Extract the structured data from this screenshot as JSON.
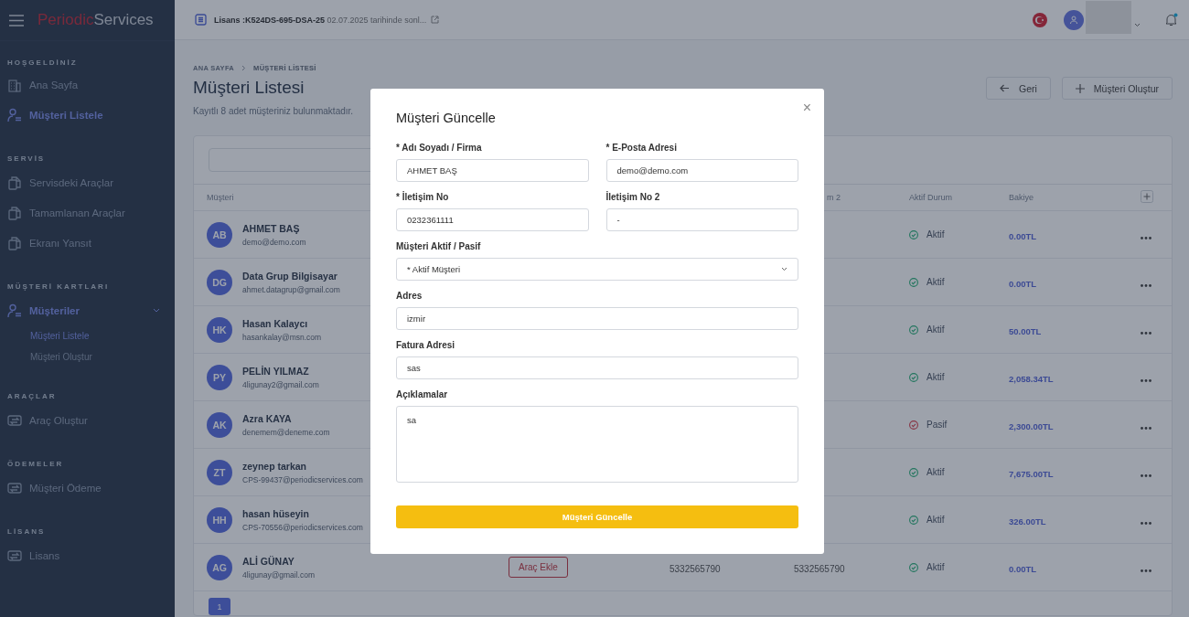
{
  "brand": {
    "first": "Periodic",
    "second": "Services"
  },
  "sidebar": {
    "sections": [
      {
        "title": "HOŞGELDİNİZ",
        "items": [
          {
            "label": "Ana Sayfa",
            "kind": "building",
            "selected": false
          },
          {
            "label": "Müşteri Listele",
            "kind": "user-list",
            "selected": true
          }
        ]
      },
      {
        "title": "SERVİS",
        "items": [
          {
            "label": "Servisdeki Araçlar",
            "kind": "copy",
            "selected": false
          },
          {
            "label": "Tamamlanan Araçlar",
            "kind": "copy",
            "selected": false
          },
          {
            "label": "Ekranı Yansıt",
            "kind": "copy",
            "selected": false
          }
        ]
      },
      {
        "title": "MÜŞTERİ KARTLARI",
        "items": [
          {
            "label": "Müşteriler",
            "kind": "user-list",
            "selected": true,
            "expanded": true,
            "children": [
              {
                "label": "Müşteri Listele",
                "selected": true
              },
              {
                "label": "Müşteri Oluştur",
                "selected": false
              }
            ]
          }
        ]
      },
      {
        "title": "ARAÇLAR",
        "items": [
          {
            "label": "Araç Oluştur",
            "kind": "transfer",
            "selected": false
          }
        ]
      },
      {
        "title": "ÖDEMELER",
        "items": [
          {
            "label": "Müşteri Ödeme",
            "kind": "transfer",
            "selected": false
          }
        ]
      },
      {
        "title": "LİSANS",
        "items": [
          {
            "label": "Lisans",
            "kind": "transfer",
            "selected": false
          }
        ]
      }
    ]
  },
  "topbar": {
    "license": "**Lisans :K524DS-695-DSA-25** 02.07.2025 tarihinde sonl...",
    "notification": true
  },
  "page": {
    "breadcrumb": [
      "ANA SAYFA",
      "MÜŞTERİ LİSTESİ"
    ],
    "title": "Müşteri Listesi",
    "subtitle": "Kayıtlı 8 adet müşteriniz bulunmaktadır.",
    "buttons": [
      {
        "label": "Geri",
        "kind": "back"
      },
      {
        "label": "Müşteri Oluştur",
        "kind": "plus"
      }
    ]
  },
  "table": {
    "columns": [
      {
        "label": "Müşteri"
      },
      {},
      {},
      {
        "label": "m 2"
      },
      {
        "label": "Aktif Durum"
      },
      {
        "label": "Bakiye"
      }
    ],
    "rows": [
      {
        "initials": "AB",
        "name": "AHMET BAŞ",
        "email": "demo@demo.com",
        "active": true,
        "status": "Aktif",
        "balance": "0.00TL"
      },
      {
        "initials": "DG",
        "name": "Data Grup Bilgisayar",
        "email": "ahmet.datagrup@gmail.com",
        "active": true,
        "status": "Aktif",
        "balance": "0.00TL"
      },
      {
        "initials": "HK",
        "name": "Hasan Kalaycı",
        "email": "hasankalay@msn.com",
        "active": true,
        "status": "Aktif",
        "balance": "50.00TL"
      },
      {
        "initials": "PY",
        "name": "PELİN YILMAZ",
        "email": "4ligunay2@gmail.com",
        "active": true,
        "status": "Aktif",
        "balance": "2,058.34TL"
      },
      {
        "initials": "AK",
        "name": "Azra KAYA",
        "email": "denemem@deneme.com",
        "active": false,
        "status": "Pasif",
        "balance": "2,300.00TL"
      },
      {
        "initials": "ZT",
        "name": "zeynep tarkan",
        "email": "CPS-99437@periodicservices.com",
        "active": true,
        "status": "Aktif",
        "balance": "7,675.00TL"
      },
      {
        "initials": "HH",
        "name": "hasan hüseyin",
        "email": "CPS-70556@periodicservices.com",
        "active": true,
        "status": "Aktif",
        "balance": "326.00TL"
      },
      {
        "initials": "AG",
        "name": "ALİ GÜNAY",
        "email": "4ligunay@gmail.com",
        "action": "Araç Ekle",
        "phone": "5332565790",
        "phone_2": "5332565790",
        "active": true,
        "status": "Aktif",
        "balance": "0.00TL"
      }
    ],
    "pages": [
      {
        "label": "1",
        "selected": true
      }
    ]
  },
  "modal": {
    "title": "Müşteri Güncelle",
    "close": "×",
    "rows": [
      [
        {
          "label": "* Adı Soyadı / Firma",
          "value": "AHMET BAŞ",
          "kind": "text"
        },
        {
          "label": "* E-Posta Adresi",
          "value": "demo@demo.com",
          "kind": "text"
        }
      ],
      [
        {
          "label": "* İletişim No",
          "value": "0232361111",
          "kind": "text"
        },
        {
          "label": "İletişim No 2",
          "value": "-",
          "kind": "text"
        }
      ],
      [
        {
          "label": "Müşteri Aktif / Pasif",
          "value": "* Aktif Müşteri",
          "kind": "select"
        }
      ],
      [
        {
          "label": "Adres",
          "value": "izmir",
          "kind": "text"
        }
      ],
      [
        {
          "label": "Fatura Adresi",
          "value": "sas",
          "kind": "text"
        }
      ],
      [
        {
          "label": "Açıklamalar",
          "value": "sa",
          "kind": "textarea"
        }
      ]
    ],
    "submit": "Müşteri Güncelle"
  }
}
